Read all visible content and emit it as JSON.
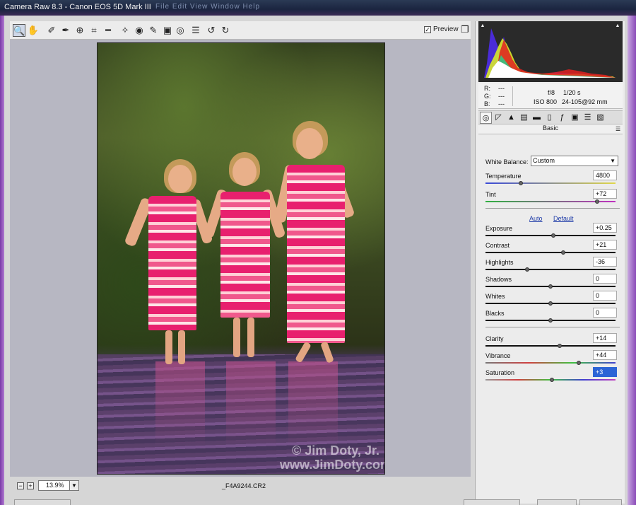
{
  "window": {
    "title": "Camera Raw 8.3  -  Canon EOS 5D Mark III",
    "ghost_menu": "File   Edit   View   Window   Help"
  },
  "toolbar": {
    "tools": [
      "zoom-tool",
      "hand-tool",
      "white-balance-tool",
      "color-sampler-tool",
      "targeted-adjustment-tool",
      "crop-tool",
      "straighten-tool",
      "spot-removal-tool",
      "red-eye-tool",
      "adjustment-brush-tool",
      "graduated-filter-tool",
      "radial-filter-tool",
      "preferences",
      "rotate-left",
      "rotate-right"
    ],
    "preview_label": "Preview",
    "preview_checked": true
  },
  "status": {
    "zoom_value": "13.9%",
    "filename": "_F4A9244.CR2"
  },
  "watermark": {
    "line1": "© Jim Doty, Jr.",
    "line2": "www.JimDoty.com"
  },
  "info": {
    "r_label": "R:",
    "r_value": "---",
    "g_label": "G:",
    "g_value": "---",
    "b_label": "B:",
    "b_value": "---",
    "aperture": "f/8",
    "shutter": "1/20 s",
    "iso": "ISO 800",
    "lens": "24-105@92 mm"
  },
  "panel": {
    "section_title": "Basic",
    "white_balance_label": "White Balance:",
    "white_balance_value": "Custom",
    "auto_label": "Auto",
    "default_label": "Default"
  },
  "sliders": {
    "temperature": {
      "label": "Temperature",
      "value": "4800",
      "level": 0.27
    },
    "tint": {
      "label": "Tint",
      "value": "+72",
      "level": 0.86
    },
    "exposure": {
      "label": "Exposure",
      "value": "+0.25",
      "level": 0.52
    },
    "contrast": {
      "label": "Contrast",
      "value": "+21",
      "level": 0.6
    },
    "highlights": {
      "label": "Highlights",
      "value": "-36",
      "level": 0.32
    },
    "shadows": {
      "label": "Shadows",
      "value": "0",
      "level": 0.5
    },
    "whites": {
      "label": "Whites",
      "value": "0",
      "level": 0.5
    },
    "blacks": {
      "label": "Blacks",
      "value": "0",
      "level": 0.5
    },
    "clarity": {
      "label": "Clarity",
      "value": "+14",
      "level": 0.57
    },
    "vibrance": {
      "label": "Vibrance",
      "value": "+44",
      "level": 0.72
    },
    "saturation": {
      "label": "Saturation",
      "value": "+3",
      "level": 0.51
    }
  },
  "colors": {
    "accent": "#2b64d6",
    "dress_pink": "#e8206e",
    "link": "#1f3ca8"
  }
}
